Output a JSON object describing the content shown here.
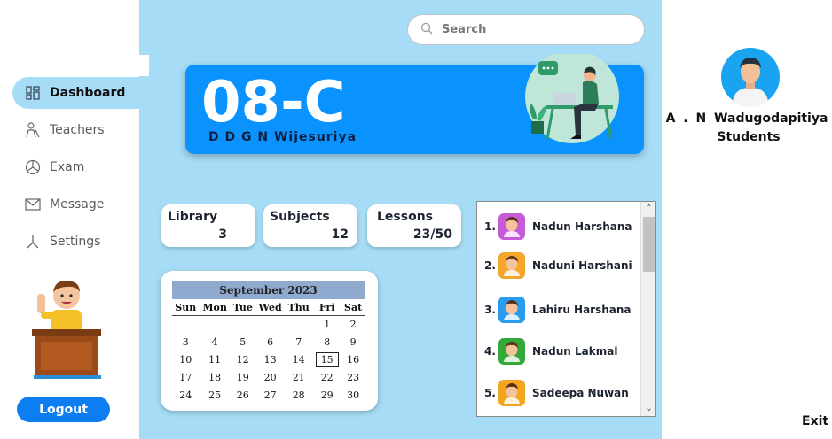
{
  "sidebar": {
    "items": [
      {
        "label": "Dashboard",
        "icon": "dashboard-icon",
        "active": true
      },
      {
        "label": "Teachers",
        "icon": "teacher-icon"
      },
      {
        "label": "Exam",
        "icon": "exam-icon"
      },
      {
        "label": "Message",
        "icon": "envelope-icon"
      },
      {
        "label": "Settings",
        "icon": "settings-icon"
      }
    ],
    "logout_label": "Logout",
    "illustration": "teacher-waving-illustration"
  },
  "search": {
    "placeholder": "Search",
    "icon": "search-icon"
  },
  "banner": {
    "class_name": "08-C",
    "teacher_name": "D D G N  Wijesuriya",
    "illustration": "person-at-laptop-illustration",
    "color": "#0a93ff"
  },
  "stats": [
    {
      "label": "Library",
      "value": "3"
    },
    {
      "label": "Subjects",
      "value": "12"
    },
    {
      "label": "Lessons",
      "value": "23/50"
    }
  ],
  "calendar": {
    "month_label": "September 2023",
    "weekdays": [
      "Sun",
      "Mon",
      "Tue",
      "Wed",
      "Thu",
      "Fri",
      "Sat"
    ],
    "weeks": [
      [
        "",
        "",
        "",
        "",
        "",
        "1",
        "2"
      ],
      [
        "3",
        "4",
        "5",
        "6",
        "7",
        "8",
        "9"
      ],
      [
        "10",
        "11",
        "12",
        "13",
        "14",
        "15",
        "16"
      ],
      [
        "17",
        "18",
        "19",
        "20",
        "21",
        "22",
        "23"
      ],
      [
        "24",
        "25",
        "26",
        "27",
        "28",
        "29",
        "30"
      ]
    ],
    "selected_day": "15"
  },
  "students": [
    {
      "num": "1.",
      "name": "Nadun Harshana",
      "avatar_color": "#c65bd8"
    },
    {
      "num": "2.",
      "name": "Naduni Harshani",
      "avatar_color": "#f4a62a"
    },
    {
      "num": "3.",
      "name": "Lahiru Harshana",
      "avatar_color": "#2a9cf0"
    },
    {
      "num": "4.",
      "name": "Nadun Lakmal",
      "avatar_color": "#35a83a"
    },
    {
      "num": "5.",
      "name": "Sadeepa Nuwan",
      "avatar_color": "#f2a51e"
    }
  ],
  "profile": {
    "name": "A . N  Wadugodapitiya",
    "role": "Students",
    "avatar": "student-avatar-icon"
  },
  "exit_label": "Exit",
  "colors": {
    "main_background": "#a6dcf5",
    "accent": "#0c7ef2"
  }
}
